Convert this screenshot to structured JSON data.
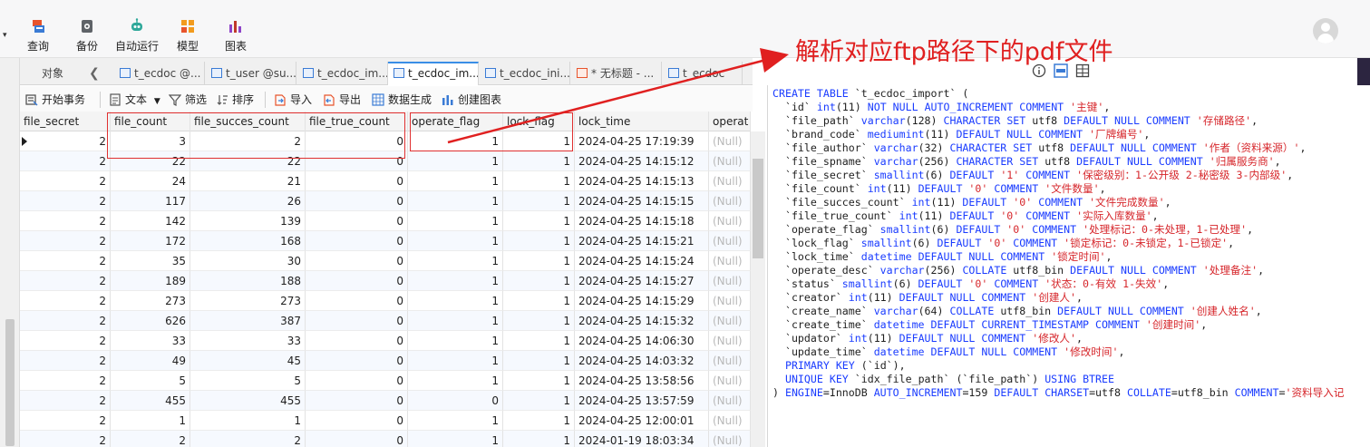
{
  "toolbar": {
    "items": [
      {
        "label": "查询",
        "icon": "query-icon"
      },
      {
        "label": "备份",
        "icon": "backup-icon"
      },
      {
        "label": "自动运行",
        "icon": "robot-icon"
      },
      {
        "label": "模型",
        "icon": "model-icon"
      },
      {
        "label": "图表",
        "icon": "chart-icon"
      }
    ]
  },
  "tabs": {
    "objects_label": "对象",
    "items": [
      {
        "label": "t_ecdoc @...",
        "active": false
      },
      {
        "label": "t_user @su...",
        "active": false
      },
      {
        "label": "t_ecdoc_im...",
        "active": false
      },
      {
        "label": "t_ecdoc_im...",
        "active": true
      },
      {
        "label": "t_ecdoc_ini...",
        "active": false
      },
      {
        "label": "* 无标题 - ...",
        "active": false
      },
      {
        "label": "t_ecdoc",
        "active": false
      }
    ]
  },
  "subtoolbar": {
    "begin_tx": "开始事务",
    "text": "文本",
    "filter": "筛选",
    "sort": "排序",
    "import": "导入",
    "export": "导出",
    "generate": "数据生成",
    "create_chart": "创建图表"
  },
  "grid": {
    "columns": [
      "file_secret",
      "file_count",
      "file_succes_count",
      "file_true_count",
      "operate_flag",
      "lock_flag",
      "lock_time",
      "operat"
    ],
    "rows": [
      [
        "2",
        "3",
        "2",
        "0",
        "1",
        "1",
        "2024-04-25 17:19:39",
        "(Null)"
      ],
      [
        "2",
        "22",
        "22",
        "0",
        "1",
        "1",
        "2024-04-25 14:15:12",
        "(Null)"
      ],
      [
        "2",
        "24",
        "21",
        "0",
        "1",
        "1",
        "2024-04-25 14:15:13",
        "(Null)"
      ],
      [
        "2",
        "117",
        "26",
        "0",
        "1",
        "1",
        "2024-04-25 14:15:15",
        "(Null)"
      ],
      [
        "2",
        "142",
        "139",
        "0",
        "1",
        "1",
        "2024-04-25 14:15:18",
        "(Null)"
      ],
      [
        "2",
        "172",
        "168",
        "0",
        "1",
        "1",
        "2024-04-25 14:15:21",
        "(Null)"
      ],
      [
        "2",
        "35",
        "30",
        "0",
        "1",
        "1",
        "2024-04-25 14:15:24",
        "(Null)"
      ],
      [
        "2",
        "189",
        "188",
        "0",
        "1",
        "1",
        "2024-04-25 14:15:27",
        "(Null)"
      ],
      [
        "2",
        "273",
        "273",
        "0",
        "1",
        "1",
        "2024-04-25 14:15:29",
        "(Null)"
      ],
      [
        "2",
        "626",
        "387",
        "0",
        "1",
        "1",
        "2024-04-25 14:15:32",
        "(Null)"
      ],
      [
        "2",
        "33",
        "33",
        "0",
        "1",
        "1",
        "2024-04-25 14:06:30",
        "(Null)"
      ],
      [
        "2",
        "49",
        "45",
        "0",
        "1",
        "1",
        "2024-04-25 14:03:32",
        "(Null)"
      ],
      [
        "2",
        "5",
        "5",
        "0",
        "1",
        "1",
        "2024-04-25 13:58:56",
        "(Null)"
      ],
      [
        "2",
        "455",
        "455",
        "0",
        "0",
        "1",
        "2024-04-25 13:57:59",
        "(Null)"
      ],
      [
        "2",
        "1",
        "1",
        "0",
        "1",
        "1",
        "2024-04-25 12:00:01",
        "(Null)"
      ],
      [
        "2",
        "2",
        "2",
        "0",
        "1",
        "1",
        "2024-01-19 18:03:34",
        "(Null)"
      ]
    ]
  },
  "annotation": {
    "text": "解析对应ftp路径下的pdf文件",
    "color": "#e02020"
  },
  "ddl": {
    "lines": [
      "CREATE TABLE `t_ecdoc_import` (",
      "  `id` int(11) NOT NULL AUTO_INCREMENT COMMENT '主键',",
      "  `file_path` varchar(128) CHARACTER SET utf8 DEFAULT NULL COMMENT '存储路径',",
      "  `brand_code` mediumint(11) DEFAULT NULL COMMENT '厂牌编号',",
      "  `file_author` varchar(32) CHARACTER SET utf8 DEFAULT NULL COMMENT '作者（资料来源）',",
      "  `file_spname` varchar(256) CHARACTER SET utf8 DEFAULT NULL COMMENT '归属服务商',",
      "  `file_secret` smallint(6) DEFAULT '1' COMMENT '保密级别：1-公开级 2-秘密级 3-内部级',",
      "  `file_count` int(11) DEFAULT '0' COMMENT '文件数量',",
      "  `file_succes_count` int(11) DEFAULT '0' COMMENT '文件完成数量',",
      "  `file_true_count` int(11) DEFAULT '0' COMMENT '实际入库数量',",
      "  `operate_flag` smallint(6) DEFAULT '0' COMMENT '处理标记：0-未处理，1-已处理',",
      "  `lock_flag` smallint(6) DEFAULT '0' COMMENT '锁定标记：0-未锁定，1-已锁定',",
      "  `lock_time` datetime DEFAULT NULL COMMENT '锁定时间',",
      "  `operate_desc` varchar(256) COLLATE utf8_bin DEFAULT NULL COMMENT '处理备注',",
      "  `status` smallint(6) DEFAULT '0' COMMENT '状态：0-有效 1-失效',",
      "  `creator` int(11) DEFAULT NULL COMMENT '创建人',",
      "  `create_name` varchar(64) COLLATE utf8_bin DEFAULT NULL COMMENT '创建人姓名',",
      "  `create_time` datetime DEFAULT CURRENT_TIMESTAMP COMMENT '创建时间',",
      "  `updator` int(11) DEFAULT NULL COMMENT '修改人',",
      "  `update_time` datetime DEFAULT NULL COMMENT '修改时间',",
      "  PRIMARY KEY (`id`),",
      "  UNIQUE KEY `idx_file_path` (`file_path`) USING BTREE",
      ") ENGINE=InnoDB AUTO_INCREMENT=159 DEFAULT CHARSET=utf8 COLLATE=utf8_bin COMMENT='资料导入记"
    ]
  }
}
